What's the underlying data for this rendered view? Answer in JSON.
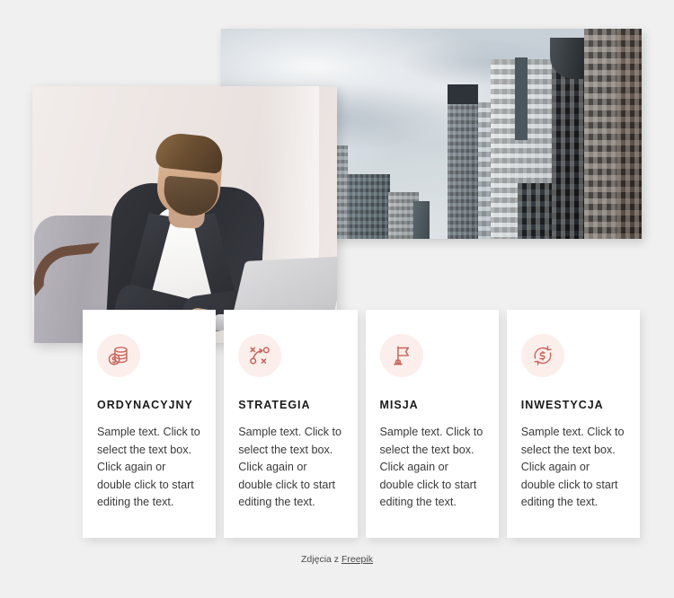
{
  "page": {
    "background_color": "#f0f0f0"
  },
  "media": {
    "city_photo": {
      "alt": "city-skyline-photo"
    },
    "man_photo": {
      "alt": "businessman-with-laptop-photo"
    }
  },
  "cards": [
    {
      "icon": "coins-stack-dollar-icon",
      "title": "ORDYNACYJNY",
      "text": "Sample text. Click to select the text box. Click again or double click to start editing the text."
    },
    {
      "icon": "strategy-playbook-icon",
      "title": "STRATEGIA",
      "text": "Sample text. Click to select the text box. Click again or double click to start editing the text."
    },
    {
      "icon": "flag-icon",
      "title": "MISJA",
      "text": "Sample text. Click to select the text box. Click again or double click to start editing the text."
    },
    {
      "icon": "money-exchange-arrows-icon",
      "title": "INWESTYCJA",
      "text": "Sample text. Click to select the text box. Click again or double click to start editing the text."
    }
  ],
  "credit": {
    "prefix": "Zdjęcia z ",
    "link_label": "Freepik"
  },
  "colors": {
    "accent": "#c8645a",
    "icon_bg": "#fbeeeb",
    "card_bg": "#ffffff",
    "heading": "#1b1b1b",
    "body_text": "#3a3a3a",
    "page_bg": "#f0f0f0"
  }
}
